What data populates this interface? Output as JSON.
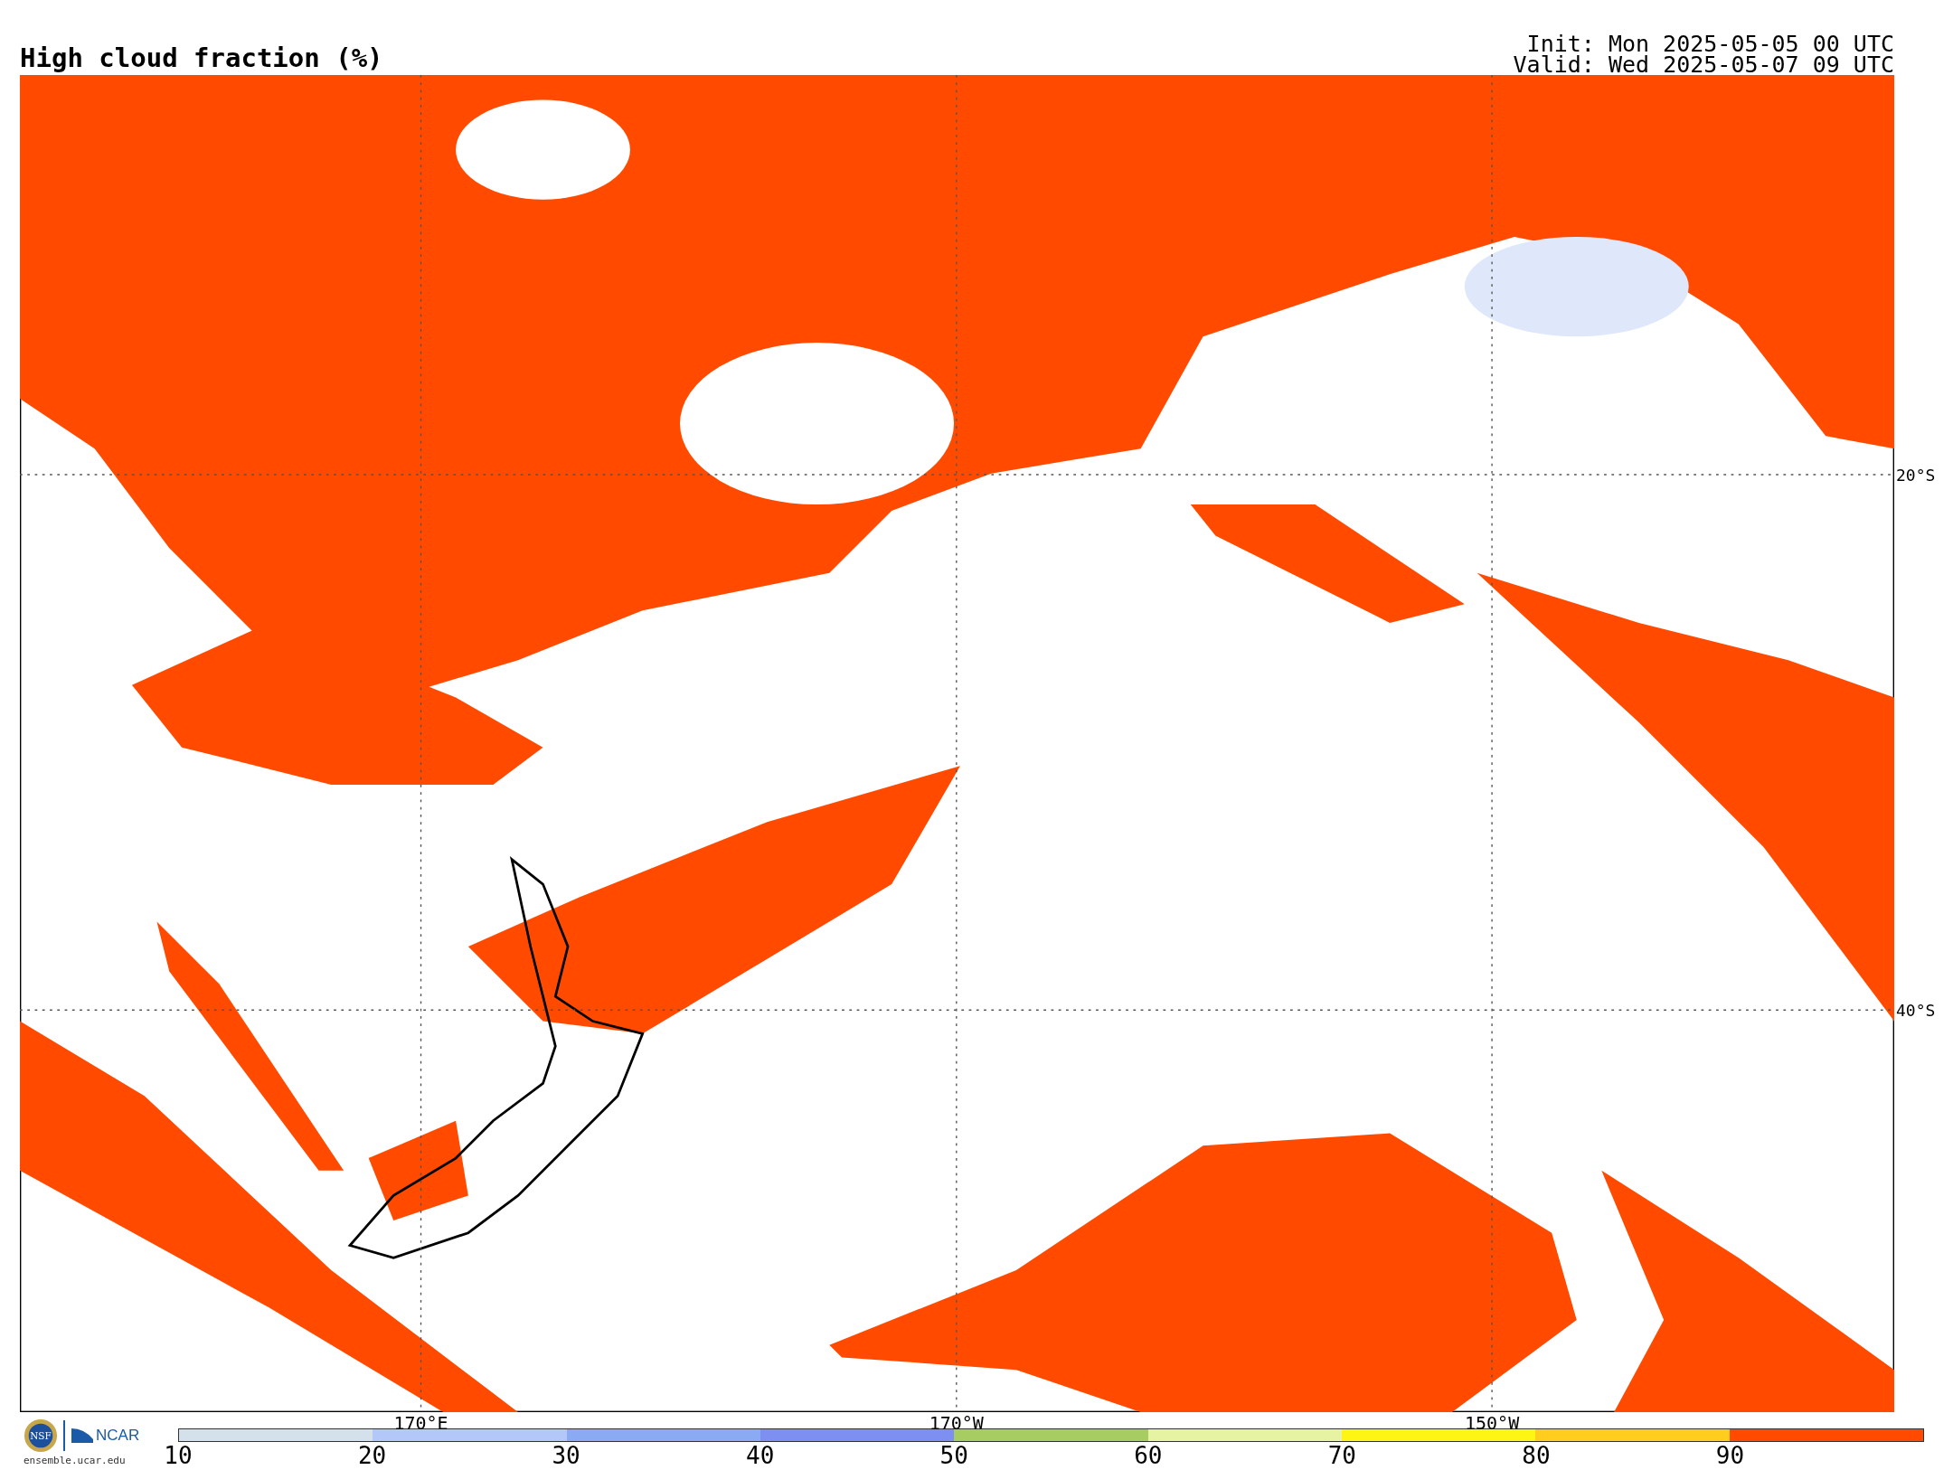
{
  "title": "High cloud fraction (%)",
  "init": "Init: Mon 2025-05-05 00 UTC",
  "valid": "Valid: Wed 2025-05-07 09 UTC",
  "map": {
    "lat_labels": [
      "20°S",
      "40°S"
    ],
    "lon_labels": [
      "170°E",
      "170°W",
      "150°W"
    ]
  },
  "footer": {
    "nsf_logo": "NSF",
    "ncar_logo": "NCAR",
    "site": "ensemble.ucar.edu"
  },
  "colorbar": {
    "segments": [
      {
        "color": "#d4e0ea"
      },
      {
        "color": "#b3c8f8"
      },
      {
        "color": "#8aaaf4"
      },
      {
        "color": "#7e8ff2"
      },
      {
        "color": "#a7cc62"
      },
      {
        "color": "#e6f3a2"
      },
      {
        "color": "#fff514"
      },
      {
        "color": "#ffcd1e"
      },
      {
        "color": "#ff4a00"
      }
    ],
    "ticks": [
      "10",
      "20",
      "30",
      "40",
      "50",
      "60",
      "70",
      "80",
      "90"
    ]
  }
}
